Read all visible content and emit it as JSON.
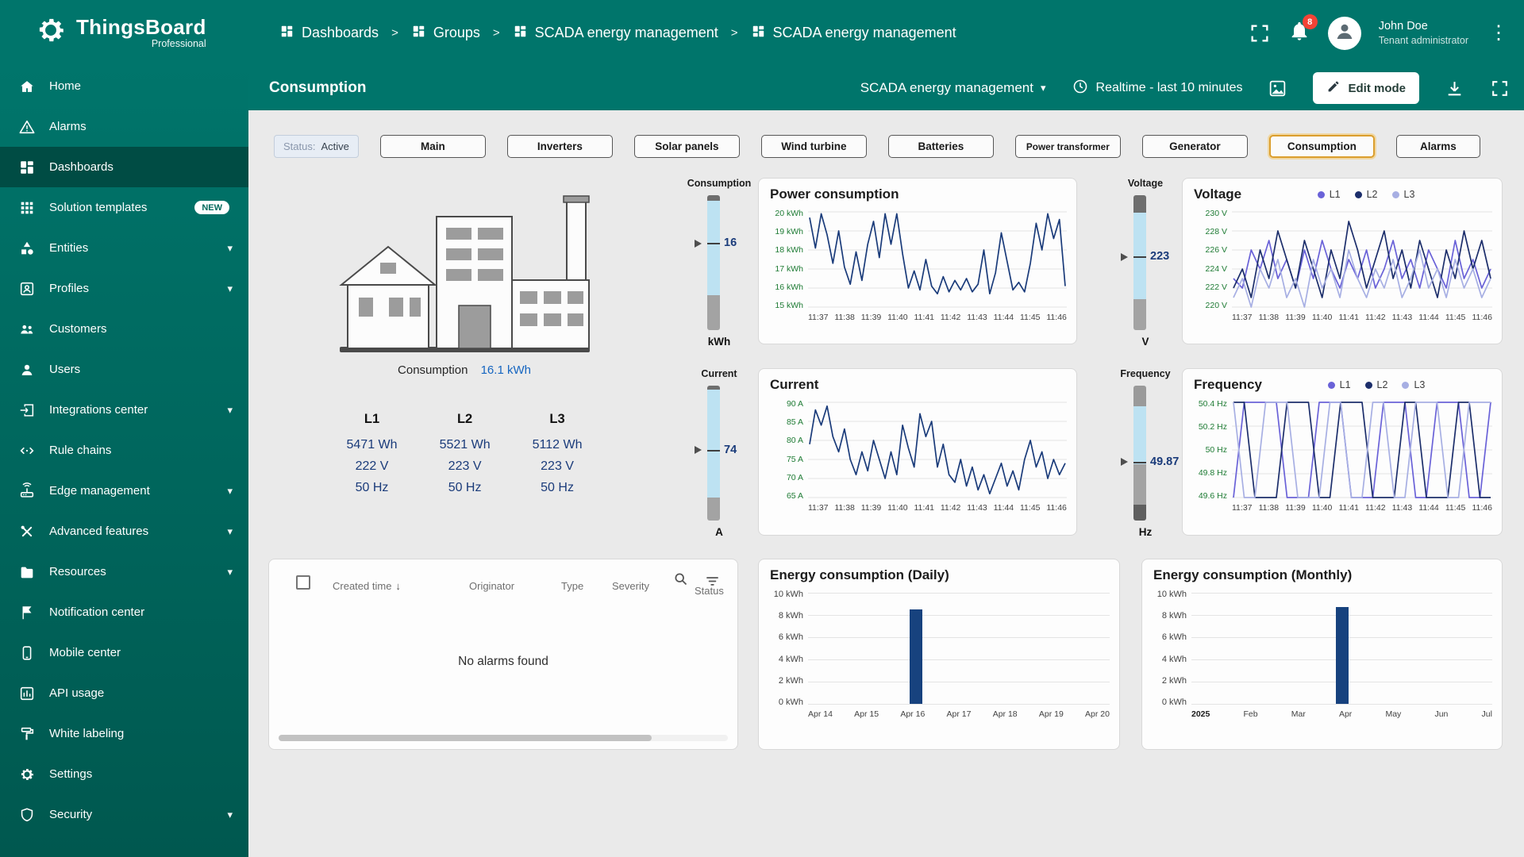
{
  "app": {
    "brand": "ThingsBoard",
    "brand_sub": "Professional",
    "notifications_badge": "8",
    "user_name": "John Doe",
    "user_role": "Tenant administrator"
  },
  "breadcrumbs": {
    "separator": ">",
    "items": [
      {
        "label": "Dashboards"
      },
      {
        "label": "Groups"
      },
      {
        "label": "SCADA energy management"
      },
      {
        "label": "SCADA energy management"
      }
    ]
  },
  "sidebar": {
    "items": [
      {
        "label": "Home"
      },
      {
        "label": "Alarms"
      },
      {
        "label": "Dashboards"
      },
      {
        "label": "Solution templates",
        "badge": "NEW"
      },
      {
        "label": "Entities"
      },
      {
        "label": "Profiles"
      },
      {
        "label": "Customers"
      },
      {
        "label": "Users"
      },
      {
        "label": "Integrations center"
      },
      {
        "label": "Rule chains"
      },
      {
        "label": "Edge management"
      },
      {
        "label": "Advanced features"
      },
      {
        "label": "Resources"
      },
      {
        "label": "Notification center"
      },
      {
        "label": "Mobile center"
      },
      {
        "label": "API usage"
      },
      {
        "label": "White labeling"
      },
      {
        "label": "Settings"
      },
      {
        "label": "Security"
      }
    ]
  },
  "toolbar": {
    "title": "Consumption",
    "dashboard_name": "SCADA energy management",
    "time_window": "Realtime - last 10 minutes",
    "edit_button": "Edit mode"
  },
  "state_buttons": {
    "status_label": "Status:",
    "status_value": "Active",
    "buttons": [
      {
        "label": "Main"
      },
      {
        "label": "Inverters"
      },
      {
        "label": "Solar panels"
      },
      {
        "label": "Wind turbine"
      },
      {
        "label": "Batteries"
      },
      {
        "label": "Power transformer"
      },
      {
        "label": "Generator"
      },
      {
        "label": "Consumption",
        "active": true
      },
      {
        "label": "Alarms"
      }
    ]
  },
  "building": {
    "caption_label": "Consumption",
    "caption_value": "16.1 kWh",
    "phases": [
      {
        "name": "L1",
        "energy": "5471 Wh",
        "voltage": "222 V",
        "frequency": "50 Hz"
      },
      {
        "name": "L2",
        "energy": "5521 Wh",
        "voltage": "223 V",
        "frequency": "50 Hz"
      },
      {
        "name": "L3",
        "energy": "5112 Wh",
        "voltage": "223 V",
        "frequency": "50 Hz"
      }
    ]
  },
  "sliders": [
    {
      "label": "Consumption",
      "value": "16",
      "unit": "kWh",
      "thumb": 0.36,
      "segments": [
        [
          "#6E6E6E",
          0.04
        ],
        [
          "#BDE2F2",
          0.7
        ],
        [
          "#A3A3A3",
          0.26
        ]
      ]
    },
    {
      "label": "Voltage",
      "value": "223",
      "unit": "V",
      "thumb": 0.46,
      "segments": [
        [
          "#6E6E6E",
          0.13
        ],
        [
          "#BDE2F2",
          0.64
        ],
        [
          "#A3A3A3",
          0.23
        ]
      ]
    },
    {
      "label": "Current",
      "value": "74",
      "unit": "A",
      "thumb": 0.48,
      "segments": [
        [
          "#6E6E6E",
          0.03
        ],
        [
          "#BDE2F2",
          0.8
        ],
        [
          "#A3A3A3",
          0.17
        ]
      ]
    },
    {
      "label": "Frequency",
      "value": "49.87",
      "unit": "Hz",
      "thumb": 0.57,
      "segments": [
        [
          "#9A9A9A",
          0.15
        ],
        [
          "#BDE2F2",
          0.43
        ],
        [
          "#A3A3A3",
          0.3
        ],
        [
          "#5F5F5F",
          0.12
        ]
      ]
    }
  ],
  "alarms": {
    "columns": [
      "Created time",
      "Originator",
      "Type",
      "Severity",
      "Status"
    ],
    "empty_text": "No alarms found"
  },
  "chart_data": [
    {
      "id": "power",
      "type": "line",
      "title": "Power consumption",
      "ylim": [
        15,
        20
      ],
      "yticks": [
        "20 kWh",
        "19 kWh",
        "18 kWh",
        "17 kWh",
        "16 kWh",
        "15 kWh"
      ],
      "xticks": [
        "11:37",
        "11:38",
        "11:39",
        "11:40",
        "11:41",
        "11:42",
        "11:43",
        "11:44",
        "11:45",
        "11:46"
      ],
      "legend": false,
      "series": [
        {
          "name": "Power consumption",
          "color": "#1A3B7A",
          "values": [
            19.7,
            18.1,
            19.9,
            18.8,
            17.3,
            19.0,
            17.1,
            16.2,
            17.9,
            16.4,
            18.3,
            19.5,
            17.6,
            19.9,
            18.3,
            19.9,
            17.8,
            16.0,
            16.9,
            15.9,
            17.5,
            16.1,
            15.7,
            16.6,
            15.8,
            16.4,
            15.9,
            16.5,
            15.8,
            16.2,
            18.0,
            15.7,
            16.8,
            18.9,
            17.4,
            15.9,
            16.3,
            15.8,
            17.3,
            19.4,
            18.0,
            19.9,
            18.6,
            19.6,
            16.1
          ]
        }
      ]
    },
    {
      "id": "voltage",
      "type": "line",
      "title": "Voltage",
      "ylim": [
        220,
        230
      ],
      "yticks": [
        "230 V",
        "228 V",
        "226 V",
        "224 V",
        "222 V",
        "220 V"
      ],
      "xticks": [
        "11:37",
        "11:38",
        "11:39",
        "11:40",
        "11:41",
        "11:42",
        "11:43",
        "11:44",
        "11:45",
        "11:46"
      ],
      "legend": true,
      "series": [
        {
          "name": "L1",
          "color": "#6A62D8",
          "values": [
            223,
            222,
            226,
            224,
            227,
            223,
            225,
            222,
            226,
            223,
            227,
            224,
            222,
            225,
            223,
            226,
            222,
            224,
            227,
            223,
            225,
            222,
            226,
            224,
            222,
            227,
            223,
            225,
            222,
            224
          ]
        },
        {
          "name": "L2",
          "color": "#1C2E6B",
          "values": [
            222,
            224,
            221,
            226,
            223,
            228,
            225,
            222,
            227,
            224,
            221,
            226,
            223,
            229,
            226,
            222,
            225,
            228,
            223,
            226,
            222,
            227,
            224,
            221,
            226,
            223,
            228,
            224,
            227,
            223
          ]
        },
        {
          "name": "L3",
          "color": "#A7AFE3",
          "values": [
            221,
            223,
            220,
            224,
            222,
            225,
            221,
            223,
            220,
            225,
            222,
            224,
            221,
            226,
            223,
            221,
            224,
            222,
            225,
            221,
            223,
            226,
            222,
            224,
            221,
            225,
            222,
            224,
            221,
            223
          ]
        }
      ]
    },
    {
      "id": "current",
      "type": "line",
      "title": "Current",
      "ylim": [
        65,
        90
      ],
      "yticks": [
        "90 A",
        "85 A",
        "80 A",
        "75 A",
        "70 A",
        "65 A"
      ],
      "xticks": [
        "11:37",
        "11:38",
        "11:39",
        "11:40",
        "11:41",
        "11:42",
        "11:43",
        "11:44",
        "11:45",
        "11:46"
      ],
      "legend": false,
      "series": [
        {
          "name": "Current",
          "color": "#1A3B7A",
          "values": [
            79,
            88,
            84,
            89,
            81,
            77,
            83,
            75,
            71,
            77,
            72,
            80,
            75,
            70,
            77,
            71,
            84,
            78,
            73,
            87,
            81,
            85,
            73,
            79,
            71,
            69,
            75,
            68,
            73,
            67,
            71,
            66,
            70,
            74,
            68,
            72,
            67,
            75,
            80,
            73,
            77,
            70,
            75,
            71,
            74
          ]
        }
      ]
    },
    {
      "id": "frequency",
      "type": "line",
      "title": "Frequency",
      "ylim": [
        49.6,
        50.4
      ],
      "yticks": [
        "50.4 Hz",
        "50.2 Hz",
        "50 Hz",
        "49.8 Hz",
        "49.6 Hz"
      ],
      "xticks": [
        "11:37",
        "11:38",
        "11:39",
        "11:40",
        "11:41",
        "11:42",
        "11:43",
        "11:44",
        "11:45",
        "11:46"
      ],
      "legend": true,
      "series": [
        {
          "name": "L1",
          "color": "#6A62D8",
          "values": [
            49.6,
            50.4,
            50.4,
            50.4,
            50.4,
            49.6,
            49.6,
            49.6,
            50.4,
            50.4,
            50.4,
            49.6,
            49.6,
            49.6,
            50.4,
            50.4,
            50.4,
            49.6,
            49.6,
            50.4,
            50.4,
            50.4,
            49.6,
            49.6,
            50.4
          ]
        },
        {
          "name": "L2",
          "color": "#1C2E6B",
          "values": [
            50.4,
            50.4,
            49.6,
            49.6,
            49.6,
            50.4,
            50.4,
            50.4,
            49.6,
            49.6,
            50.4,
            50.4,
            50.4,
            49.6,
            49.6,
            49.6,
            50.4,
            50.4,
            49.6,
            49.6,
            49.6,
            50.4,
            50.4,
            49.6,
            49.6
          ]
        },
        {
          "name": "L3",
          "color": "#A7AFE3",
          "values": [
            50.4,
            49.6,
            49.6,
            50.4,
            50.4,
            50.4,
            49.6,
            49.6,
            49.6,
            50.4,
            50.4,
            49.6,
            49.6,
            50.4,
            50.4,
            49.6,
            49.6,
            50.4,
            50.4,
            50.4,
            49.6,
            49.6,
            50.4,
            50.4,
            50.4
          ]
        }
      ]
    },
    {
      "id": "daily",
      "type": "bar",
      "title": "Energy consumption (Daily)",
      "ylim": [
        0,
        10
      ],
      "yticks": [
        "10 kWh",
        "8 kWh",
        "6 kWh",
        "4 kWh",
        "2 kWh",
        "0 kWh"
      ],
      "categories": [
        "Apr 14",
        "Apr 15",
        "Apr 16",
        "Apr 17",
        "Apr 18",
        "Apr 19",
        "Apr 20"
      ],
      "values": [
        0,
        0,
        8.5,
        0,
        0,
        0,
        0
      ],
      "color": "#17427E",
      "bold_first": false
    },
    {
      "id": "monthly",
      "type": "bar",
      "title": "Energy consumption (Monthly)",
      "ylim": [
        0,
        10
      ],
      "yticks": [
        "10 kWh",
        "8 kWh",
        "6 kWh",
        "4 kWh",
        "2 kWh",
        "0 kWh"
      ],
      "categories": [
        "2025",
        "Feb",
        "Mar",
        "Apr",
        "May",
        "Jun",
        "Jul"
      ],
      "values": [
        0,
        0,
        0,
        8.7,
        0,
        0,
        0
      ],
      "color": "#17427E",
      "bold_first": true
    }
  ]
}
